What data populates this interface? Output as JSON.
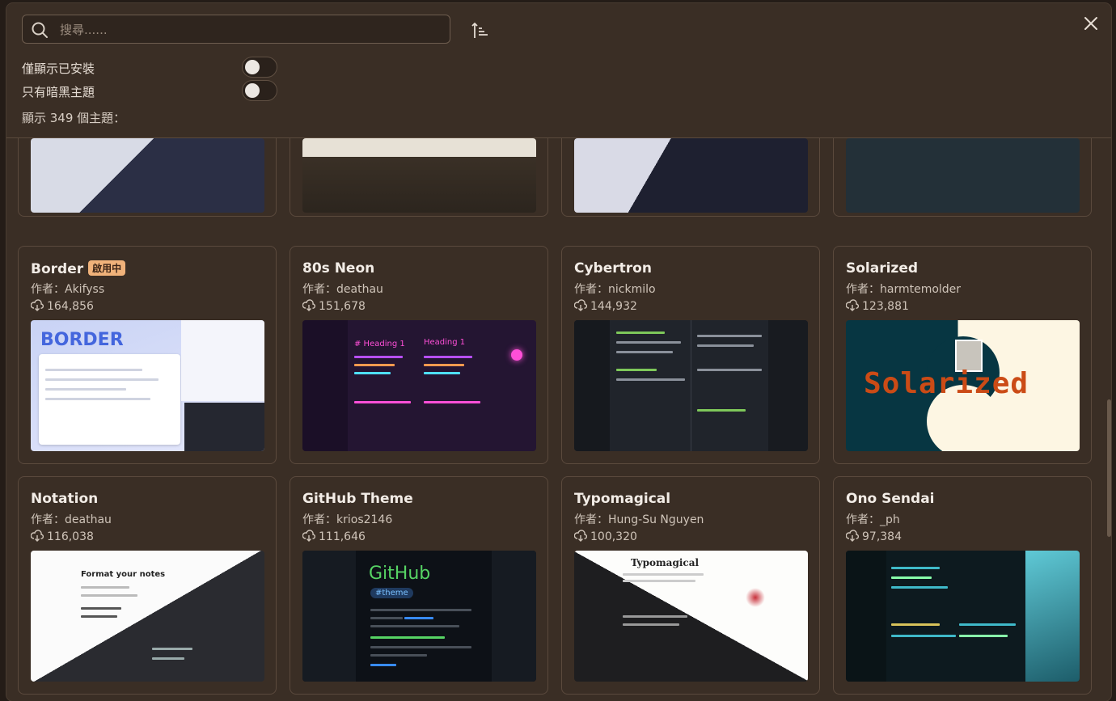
{
  "search": {
    "placeholder": "搜尋......",
    "value": ""
  },
  "filters": {
    "installed_only_label": "僅顯示已安裝",
    "dark_only_label": "只有暗黑主題"
  },
  "count_text": "顯示 349 個主題：",
  "icons": {
    "search": "search-icon",
    "sort": "sort-ascending-icon",
    "close": "close-icon",
    "download": "download-icon"
  },
  "colors": {
    "background": "#3a2e25",
    "badge": "#f0b27a",
    "border": "#5b4a3d"
  },
  "themes": [
    {
      "name": "Border",
      "badge": "啟用中",
      "author": "作者：Akifyss",
      "downloads": "164,856",
      "thumb_text": "BORDER"
    },
    {
      "name": "80s Neon",
      "badge": "",
      "author": "作者：deathau",
      "downloads": "151,678",
      "thumb_text": "# Heading 1"
    },
    {
      "name": "Cybertron",
      "badge": "",
      "author": "作者：nickmilo",
      "downloads": "144,932",
      "thumb_text": ""
    },
    {
      "name": "Solarized",
      "badge": "",
      "author": "作者：harmtemolder",
      "downloads": "123,881",
      "thumb_text": "Solarized"
    },
    {
      "name": "Notation",
      "badge": "",
      "author": "作者：deathau",
      "downloads": "116,038",
      "thumb_text": "Format your notes"
    },
    {
      "name": "GitHub Theme",
      "badge": "",
      "author": "作者：krios2146",
      "downloads": "111,646",
      "thumb_text": "GitHub",
      "thumb_tag": "#theme"
    },
    {
      "name": "Typomagical",
      "badge": "",
      "author": "作者：Hung-Su Nguyen",
      "downloads": "100,320",
      "thumb_text": "Typomagical"
    },
    {
      "name": "Ono Sendai",
      "badge": "",
      "author": "作者：_ph",
      "downloads": "97,384",
      "thumb_text": ""
    }
  ]
}
